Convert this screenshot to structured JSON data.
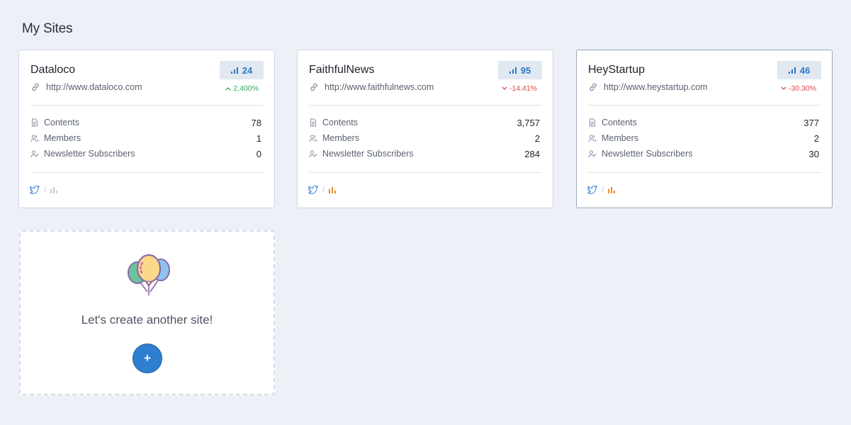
{
  "page": {
    "title": "My Sites"
  },
  "sites": [
    {
      "name": "Dataloco",
      "url": "http://www.dataloco.com",
      "score": "24",
      "trend": "2,400%",
      "trend_direction": "up",
      "contents_label": "Contents",
      "contents": "78",
      "members_label": "Members",
      "members": "1",
      "subscribers_label": "Newsletter Subscribers",
      "subscribers": "0",
      "analytics_color": "#c4cad4"
    },
    {
      "name": "FaithfulNews",
      "url": "http://www.faithfulnews.com",
      "score": "95",
      "trend": "-14.41%",
      "trend_direction": "down",
      "contents_label": "Contents",
      "contents": "3,757",
      "members_label": "Members",
      "members": "2",
      "subscribers_label": "Newsletter Subscribers",
      "subscribers": "284",
      "analytics_color": "#f08a24"
    },
    {
      "name": "HeyStartup",
      "url": "http://www.heystartup.com",
      "score": "46",
      "trend": "-30.30%",
      "trend_direction": "down",
      "contents_label": "Contents",
      "contents": "377",
      "members_label": "Members",
      "members": "2",
      "subscribers_label": "Newsletter Subscribers",
      "subscribers": "30",
      "analytics_color": "#f08a24"
    }
  ],
  "footer_separator": "/",
  "new_site": {
    "text": "Let's create another site!",
    "button_label": "+"
  },
  "colors": {
    "accent": "#2f7fd0",
    "up": "#2ea95a",
    "down": "#e04646",
    "twitter": "#3b86d4"
  },
  "icons": [
    "link-icon",
    "bar-chart-icon",
    "document-icon",
    "members-icon",
    "subscriber-icon",
    "twitter-icon",
    "balloons-icon"
  ]
}
